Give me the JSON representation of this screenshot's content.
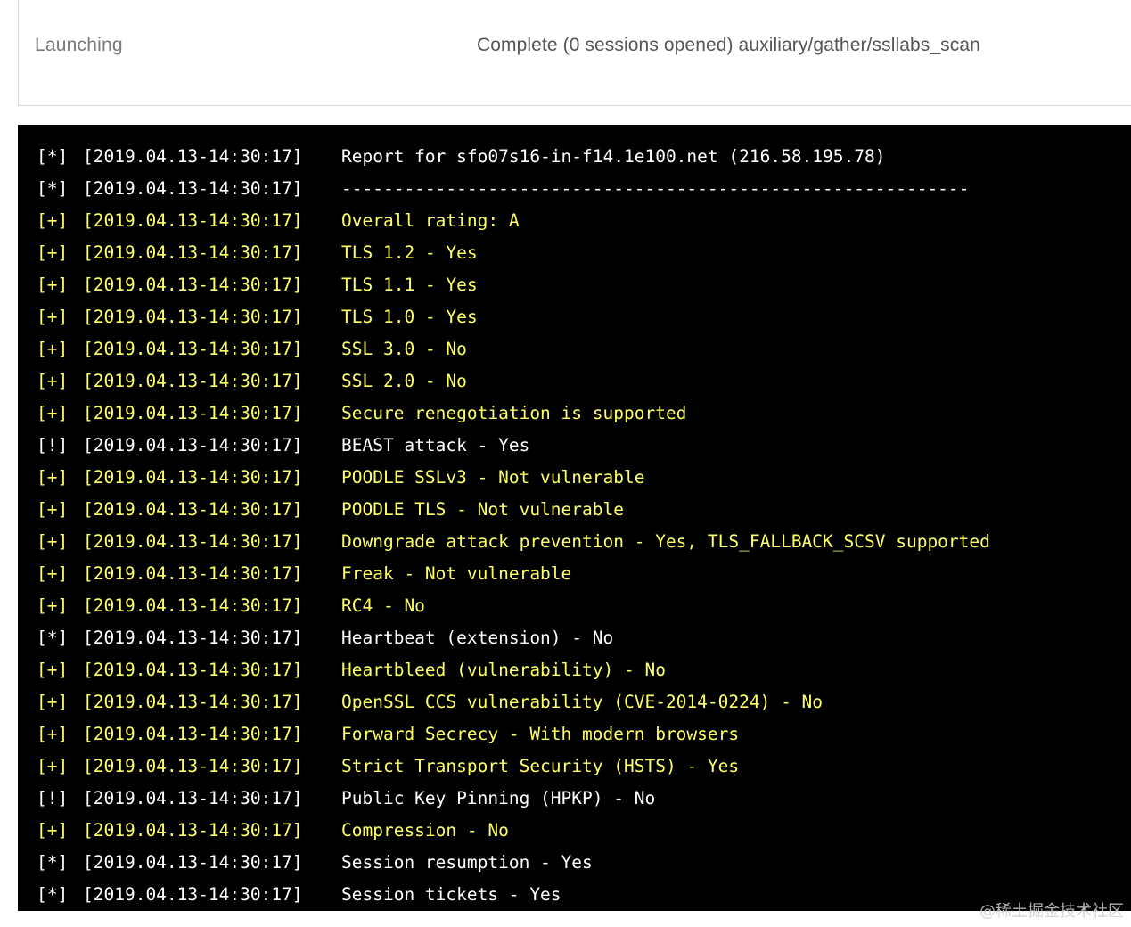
{
  "status": {
    "state": "Launching",
    "message": "Complete (0 sessions opened) auxiliary/gather/ssllabs_scan"
  },
  "console": {
    "colors": {
      "info": "#ffffff",
      "good": "#ffff66",
      "warn": "#ffffff",
      "background": "#000000"
    },
    "lines": [
      {
        "prefix": "[*]",
        "level": "info",
        "timestamp": "[2019.04.13-14:30:17]",
        "text": "Report for sfo07s16-in-f14.1e100.net (216.58.195.78)"
      },
      {
        "prefix": "[*]",
        "level": "info",
        "timestamp": "[2019.04.13-14:30:17]",
        "text": "------------------------------------------------------------"
      },
      {
        "prefix": "[+]",
        "level": "good",
        "timestamp": "[2019.04.13-14:30:17]",
        "text": "Overall rating: A"
      },
      {
        "prefix": "[+]",
        "level": "good",
        "timestamp": "[2019.04.13-14:30:17]",
        "text": "TLS 1.2 - Yes"
      },
      {
        "prefix": "[+]",
        "level": "good",
        "timestamp": "[2019.04.13-14:30:17]",
        "text": "TLS 1.1 - Yes"
      },
      {
        "prefix": "[+]",
        "level": "good",
        "timestamp": "[2019.04.13-14:30:17]",
        "text": "TLS 1.0 - Yes"
      },
      {
        "prefix": "[+]",
        "level": "good",
        "timestamp": "[2019.04.13-14:30:17]",
        "text": "SSL 3.0 - No"
      },
      {
        "prefix": "[+]",
        "level": "good",
        "timestamp": "[2019.04.13-14:30:17]",
        "text": "SSL 2.0 - No"
      },
      {
        "prefix": "[+]",
        "level": "good",
        "timestamp": "[2019.04.13-14:30:17]",
        "text": "Secure renegotiation is supported"
      },
      {
        "prefix": "[!]",
        "level": "warn",
        "timestamp": "[2019.04.13-14:30:17]",
        "text": "BEAST attack - Yes"
      },
      {
        "prefix": "[+]",
        "level": "good",
        "timestamp": "[2019.04.13-14:30:17]",
        "text": "POODLE SSLv3 - Not vulnerable"
      },
      {
        "prefix": "[+]",
        "level": "good",
        "timestamp": "[2019.04.13-14:30:17]",
        "text": "POODLE TLS - Not vulnerable"
      },
      {
        "prefix": "[+]",
        "level": "good",
        "timestamp": "[2019.04.13-14:30:17]",
        "text": "Downgrade attack prevention - Yes, TLS_FALLBACK_SCSV supported"
      },
      {
        "prefix": "[+]",
        "level": "good",
        "timestamp": "[2019.04.13-14:30:17]",
        "text": "Freak - Not vulnerable"
      },
      {
        "prefix": "[+]",
        "level": "good",
        "timestamp": "[2019.04.13-14:30:17]",
        "text": "RC4 - No"
      },
      {
        "prefix": "[*]",
        "level": "info",
        "timestamp": "[2019.04.13-14:30:17]",
        "text": "Heartbeat (extension) - No"
      },
      {
        "prefix": "[+]",
        "level": "good",
        "timestamp": "[2019.04.13-14:30:17]",
        "text": "Heartbleed (vulnerability) - No"
      },
      {
        "prefix": "[+]",
        "level": "good",
        "timestamp": "[2019.04.13-14:30:17]",
        "text": "OpenSSL CCS vulnerability (CVE-2014-0224) - No"
      },
      {
        "prefix": "[+]",
        "level": "good",
        "timestamp": "[2019.04.13-14:30:17]",
        "text": "Forward Secrecy - With modern browsers"
      },
      {
        "prefix": "[+]",
        "level": "good",
        "timestamp": "[2019.04.13-14:30:17]",
        "text": "Strict Transport Security (HSTS) - Yes"
      },
      {
        "prefix": "[!]",
        "level": "warn",
        "timestamp": "[2019.04.13-14:30:17]",
        "text": "Public Key Pinning (HPKP) - No"
      },
      {
        "prefix": "[+]",
        "level": "good",
        "timestamp": "[2019.04.13-14:30:17]",
        "text": "Compression - No"
      },
      {
        "prefix": "[*]",
        "level": "info",
        "timestamp": "[2019.04.13-14:30:17]",
        "text": "Session resumption - Yes"
      },
      {
        "prefix": "[*]",
        "level": "info",
        "timestamp": "[2019.04.13-14:30:17]",
        "text": "Session tickets - Yes"
      }
    ]
  },
  "watermark": "@稀土掘金技术社区"
}
